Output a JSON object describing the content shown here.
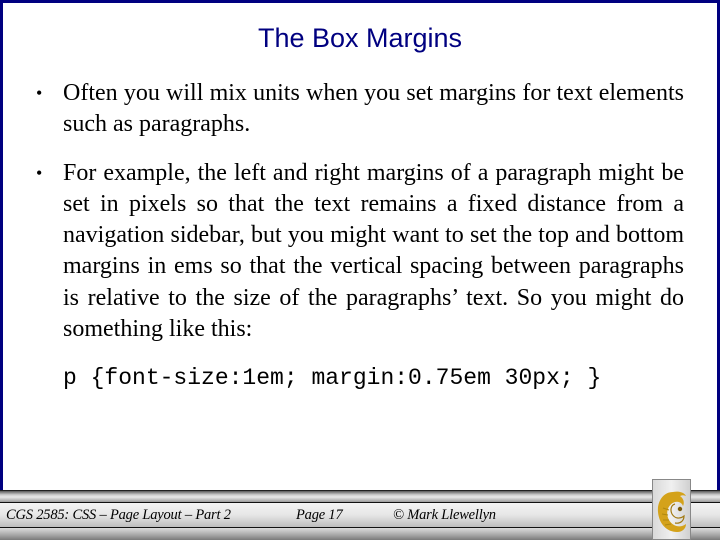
{
  "slide": {
    "title": "The Box Margins",
    "bullets": [
      {
        "text": "Often you will mix units when you set margins for text elements such as paragraphs."
      },
      {
        "text": "For example, the left and right margins of a paragraph might be set in pixels so that the text remains a fixed distance from a navigation sidebar, but you might want to set the top and bottom margins in ems so that the vertical spacing between paragraphs is relative to the size of the paragraphs’ text.  So you might do something like this:"
      }
    ],
    "bullet_glyph": "•",
    "code_example": "p {font-size:1em; margin:0.75em 30px; }"
  },
  "footer": {
    "course": "CGS 2585: CSS – Page Layout – Part 2",
    "page": "Page 17",
    "copyright": "© Mark Llewellyn",
    "logo_icon": "pegasus-logo-icon"
  },
  "colors": {
    "title": "#000080",
    "border": "#000080",
    "logo_gold": "#d4a21a"
  }
}
